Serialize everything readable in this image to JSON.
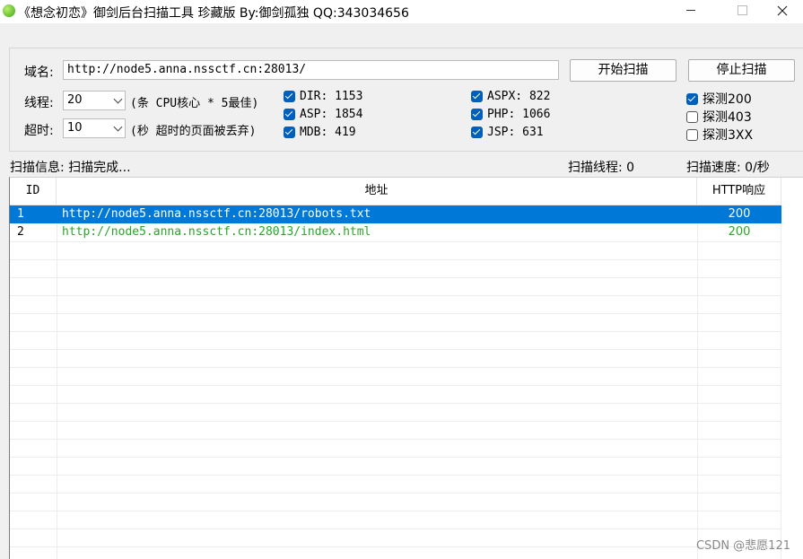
{
  "window": {
    "title": "《想念初恋》御剑后台扫描工具 珍藏版 By:御剑孤独 QQ:343034656"
  },
  "settings": {
    "domain_label": "域名:",
    "domain_value": "http://node5.anna.nssctf.cn:28013/",
    "threads_label": "线程:",
    "threads_value": "20",
    "threads_hint": "(条 CPU核心 * 5最佳)",
    "timeout_label": "超时:",
    "timeout_value": "10",
    "timeout_hint": "(秒 超时的页面被丢弃)",
    "start_button": "开始扫描",
    "stop_button": "停止扫描"
  },
  "dicts": [
    {
      "label": "DIR: 1153",
      "checked": true
    },
    {
      "label": "ASP: 1854",
      "checked": true
    },
    {
      "label": "MDB: 419",
      "checked": true
    },
    {
      "label": "ASPX: 822",
      "checked": true
    },
    {
      "label": "PHP: 1066",
      "checked": true
    },
    {
      "label": "JSP: 631",
      "checked": true
    }
  ],
  "probes": [
    {
      "label": "探测200",
      "checked": true
    },
    {
      "label": "探测403",
      "checked": false
    },
    {
      "label": "探测3XX",
      "checked": false
    }
  ],
  "status": {
    "info": "扫描信息: 扫描完成...",
    "threads": "扫描线程: 0",
    "speed": "扫描速度: 0/秒"
  },
  "table": {
    "columns": [
      "ID",
      "地址",
      "HTTP响应"
    ],
    "rows": [
      {
        "id": "1",
        "url": "http://node5.anna.nssctf.cn:28013/robots.txt",
        "code": "200",
        "selected": true
      },
      {
        "id": "2",
        "url": "http://node5.anna.nssctf.cn:28013/index.html",
        "code": "200",
        "selected": false
      }
    ]
  },
  "watermark": "CSDN @悲愿121",
  "colors": {
    "selection": "#0078d7",
    "ok_text": "#2aa52a",
    "checkbox": "#005fb8"
  }
}
